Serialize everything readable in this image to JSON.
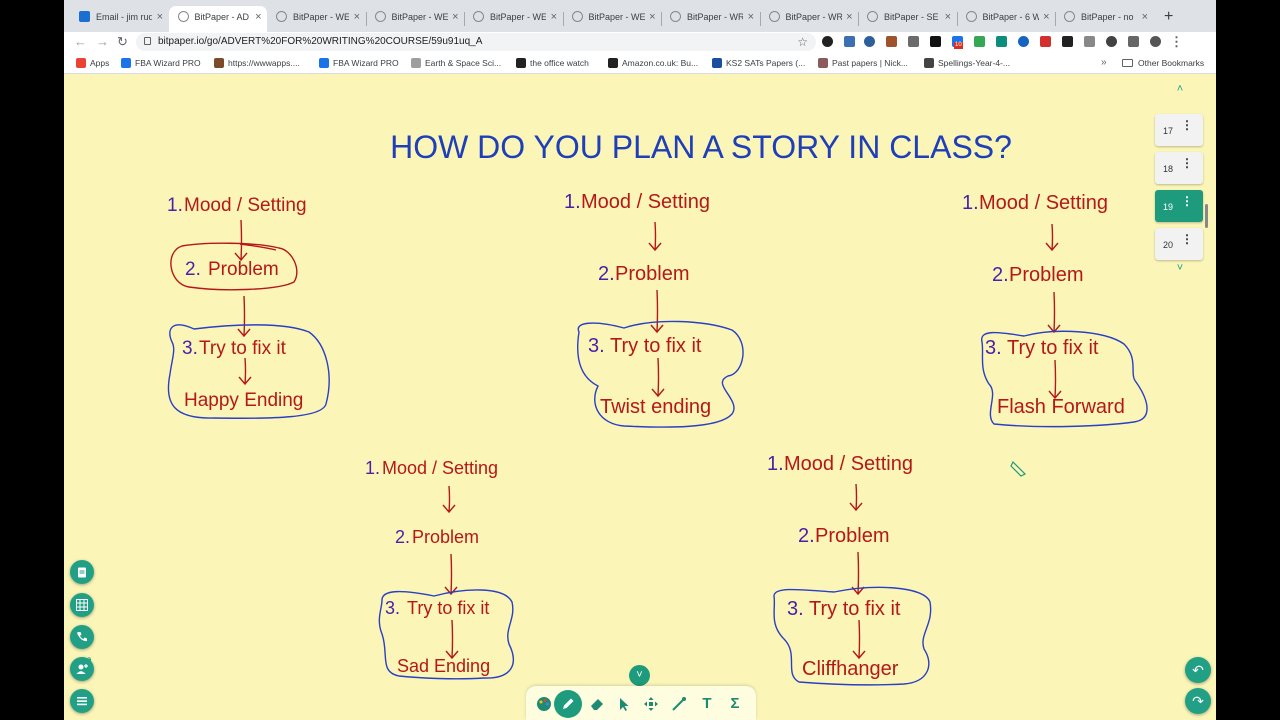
{
  "browser": {
    "tabs": [
      {
        "label": "Email - jim rud",
        "icon": "mail-icon"
      },
      {
        "label": "BitPaper - AD",
        "icon": "bitpaper-icon",
        "active": true
      },
      {
        "label": "BitPaper - WE",
        "icon": "bitpaper-icon"
      },
      {
        "label": "BitPaper - WE",
        "icon": "bitpaper-icon"
      },
      {
        "label": "BitPaper - WE",
        "icon": "bitpaper-icon"
      },
      {
        "label": "BitPaper - WE",
        "icon": "bitpaper-icon"
      },
      {
        "label": "BitPaper - WR",
        "icon": "bitpaper-icon"
      },
      {
        "label": "BitPaper - WR",
        "icon": "bitpaper-icon"
      },
      {
        "label": "BitPaper - SE",
        "icon": "bitpaper-icon"
      },
      {
        "label": "BitPaper - 6 W",
        "icon": "bitpaper-icon"
      },
      {
        "label": "BitPaper - no",
        "icon": "bitpaper-icon"
      }
    ],
    "new_tab": "+",
    "close_glyph": "×",
    "url": "bitpaper.io/go/ADVERT%20FOR%20WRITING%20COURSE/59u91uq_A",
    "bookmarks": [
      {
        "label": "Apps",
        "color": "#ea4335"
      },
      {
        "label": "FBA Wizard PRO",
        "color": "#1a73e8"
      },
      {
        "label": "https://wwwapps....",
        "color": "#7b4b2a"
      },
      {
        "label": "FBA Wizard PRO",
        "color": "#1a73e8"
      },
      {
        "label": "Earth & Space Sci...",
        "color": "#9e9e9e"
      },
      {
        "label": "the office watch",
        "color": "#222222"
      },
      {
        "label": "Amazon.co.uk: Bu...",
        "color": "#222222"
      },
      {
        "label": "KS2 SATs Papers (...",
        "color": "#1a4fa0"
      },
      {
        "label": "Past papers | Nick...",
        "color": "#8b5a5a"
      },
      {
        "label": "Spellings-Year-4-...",
        "color": "#444444"
      }
    ],
    "bookmarks_more": "»",
    "other_bookmarks": "Other Bookmarks",
    "extension_badge": "10"
  },
  "board": {
    "title": "HOW DO YOU PLAN A STORY IN CLASS?",
    "plans": [
      {
        "n1": "1.",
        "mood": "Mood / Setting",
        "n2": "2.",
        "problem": "Problem",
        "n3": "3.",
        "fix": "Try to fix it",
        "ending": "Happy Ending"
      },
      {
        "n1": "1.",
        "mood": "Mood / Setting",
        "n2": "2.",
        "problem": "Problem",
        "n3": "3.",
        "fix": "Try to fix it",
        "ending": "Twist ending"
      },
      {
        "n1": "1.",
        "mood": "Mood / Setting",
        "n2": "2.",
        "problem": "Problem",
        "n3": "3.",
        "fix": "Try to fix it",
        "ending": "Flash Forward"
      },
      {
        "n1": "1.",
        "mood": "Mood / Setting",
        "n2": "2.",
        "problem": "Problem",
        "n3": "3.",
        "fix": "Try to fix it",
        "ending": "Sad Ending"
      },
      {
        "n1": "1.",
        "mood": "Mood / Setting",
        "n2": "2.",
        "problem": "Problem",
        "n3": "3.",
        "fix": "Try to fix it",
        "ending": "Cliffhanger"
      }
    ],
    "colors": {
      "ink_red": "#b51818",
      "ink_blue": "#2a3fc4",
      "ink_purple": "#4b1fa8",
      "title_blue": "#1f3fb8",
      "paper": "#fbf6b8",
      "accent_green": "#1e9b7c"
    }
  },
  "pages": {
    "items": [
      "17",
      "18",
      "19",
      "20"
    ],
    "current": "19",
    "menu_glyph": "⋮",
    "up_glyph": "˄",
    "down_glyph": "˅"
  },
  "tools": {
    "left": [
      "clipboard-icon",
      "grid-icon",
      "phone-icon",
      "add-user-icon",
      "menu-icon"
    ],
    "bottom": [
      "palette-icon",
      "pen-icon",
      "eraser-icon",
      "pointer-icon",
      "move-icon",
      "laser-icon",
      "text-icon",
      "sigma-icon"
    ],
    "text_tool": "T",
    "sigma_tool": "Σ",
    "undo": "↶",
    "redo": "↷"
  }
}
